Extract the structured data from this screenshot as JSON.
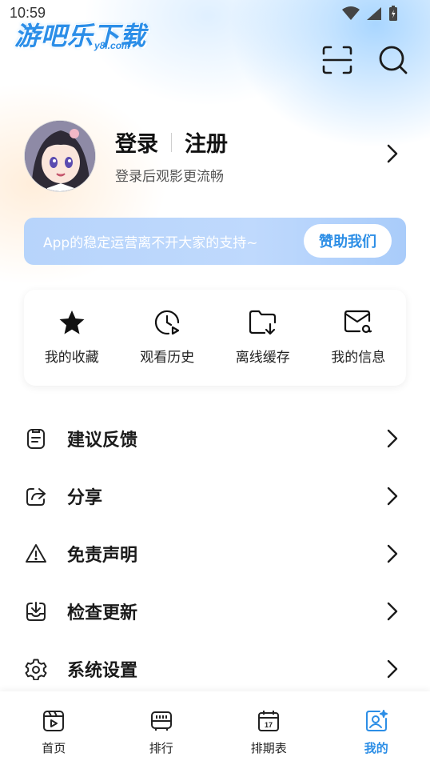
{
  "status": {
    "time": "10:59"
  },
  "brand": {
    "name": "游吧乐下载",
    "domain": "y8l.com",
    "color": "#2b8ee8"
  },
  "header": {
    "actions": [
      {
        "icon": "scan-icon"
      },
      {
        "icon": "search-icon"
      }
    ]
  },
  "profile": {
    "login_label": "登录",
    "register_label": "注册",
    "subtitle": "登录后观影更流畅"
  },
  "sponsor": {
    "text": "App的稳定运营离不开大家的支持~",
    "button_label": "赞助我们",
    "accent": "#2c8ee6"
  },
  "quick_actions": [
    {
      "label": "我的收藏",
      "icon": "star-icon"
    },
    {
      "label": "观看历史",
      "icon": "history-clock-icon"
    },
    {
      "label": "离线缓存",
      "icon": "download-folder-icon"
    },
    {
      "label": "我的信息",
      "icon": "mail-at-icon"
    }
  ],
  "menu": [
    {
      "label": "建议反馈",
      "icon": "clipboard-icon"
    },
    {
      "label": "分享",
      "icon": "share-icon"
    },
    {
      "label": "免责声明",
      "icon": "warning-icon"
    },
    {
      "label": "检查更新",
      "icon": "update-download-icon"
    },
    {
      "label": "系统设置",
      "icon": "gear-icon"
    }
  ],
  "tabs": [
    {
      "label": "首页",
      "icon": "play-card-icon",
      "active": false
    },
    {
      "label": "排行",
      "icon": "ranking-icon",
      "active": false
    },
    {
      "label": "排期表",
      "icon": "calendar-icon",
      "active": false
    },
    {
      "label": "我的",
      "icon": "profile-icon",
      "active": true
    }
  ]
}
